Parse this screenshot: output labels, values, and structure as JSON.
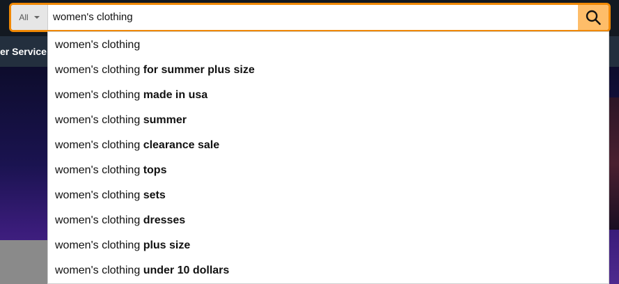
{
  "search": {
    "scope_label": "All",
    "query": "women's clothing",
    "submit_icon": "search-icon"
  },
  "nav": {
    "partial_item": "er Service"
  },
  "suggestions": [
    {
      "prefix": "women's clothing",
      "suffix": ""
    },
    {
      "prefix": "women's clothing",
      "suffix": "for summer plus size"
    },
    {
      "prefix": "women's clothing",
      "suffix": "made in usa"
    },
    {
      "prefix": "women's clothing",
      "suffix": "summer"
    },
    {
      "prefix": "women's clothing",
      "suffix": "clearance sale"
    },
    {
      "prefix": "women's clothing",
      "suffix": "tops"
    },
    {
      "prefix": "women's clothing",
      "suffix": "sets"
    },
    {
      "prefix": "women's clothing",
      "suffix": "dresses"
    },
    {
      "prefix": "women's clothing",
      "suffix": "plus size"
    },
    {
      "prefix": "women's clothing",
      "suffix": "under 10 dollars"
    }
  ],
  "colors": {
    "accent_border": "#f08804",
    "search_button": "#febd69",
    "header_bg": "#131921",
    "subnav_bg": "#232f3e"
  }
}
